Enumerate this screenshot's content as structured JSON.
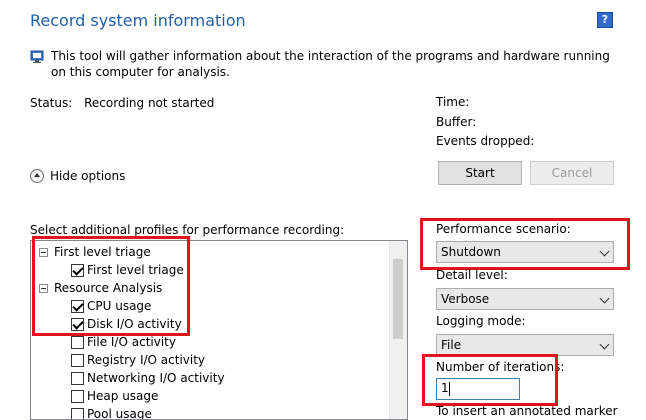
{
  "window": {
    "title": "Record system information",
    "help_symbol": "?"
  },
  "intro": {
    "text": "This tool will gather information about the interaction of the programs and hardware running on this computer for analysis."
  },
  "status": {
    "label": "Status:",
    "value": "Recording not started"
  },
  "metrics": {
    "time_label": "Time:",
    "buffer_label": "Buffer:",
    "events_dropped_label": "Events dropped:"
  },
  "buttons": {
    "start": "Start",
    "cancel": "Cancel"
  },
  "options_toggle": {
    "label": "Hide options"
  },
  "profiles": {
    "label": "Select additional profiles for performance recording:",
    "items": [
      {
        "label": "First level triage",
        "type": "group",
        "expanded": true
      },
      {
        "label": "First level triage",
        "type": "check",
        "checked": true
      },
      {
        "label": "Resource Analysis",
        "type": "group",
        "expanded": true
      },
      {
        "label": "CPU usage",
        "type": "check",
        "checked": true
      },
      {
        "label": "Disk I/O activity",
        "type": "check",
        "checked": true
      },
      {
        "label": "File I/O activity",
        "type": "check",
        "checked": false
      },
      {
        "label": "Registry I/O activity",
        "type": "check",
        "checked": false
      },
      {
        "label": "Networking I/O activity",
        "type": "check",
        "checked": false
      },
      {
        "label": "Heap usage",
        "type": "check",
        "checked": false
      },
      {
        "label": "Pool usage",
        "type": "check",
        "checked": false
      }
    ]
  },
  "settings": {
    "performance_scenario": {
      "label": "Performance scenario:",
      "value": "Shutdown"
    },
    "detail_level": {
      "label": "Detail level:",
      "value": "Verbose"
    },
    "logging_mode": {
      "label": "Logging mode:",
      "value": "File"
    },
    "iterations": {
      "label": "Number of iterations:",
      "value": "1"
    },
    "marker_hint": "To insert an annotated marker"
  },
  "colors": {
    "title": "#1e5fa8",
    "highlight_box": "#e0141e",
    "help_icon": "#2f6cc7"
  }
}
